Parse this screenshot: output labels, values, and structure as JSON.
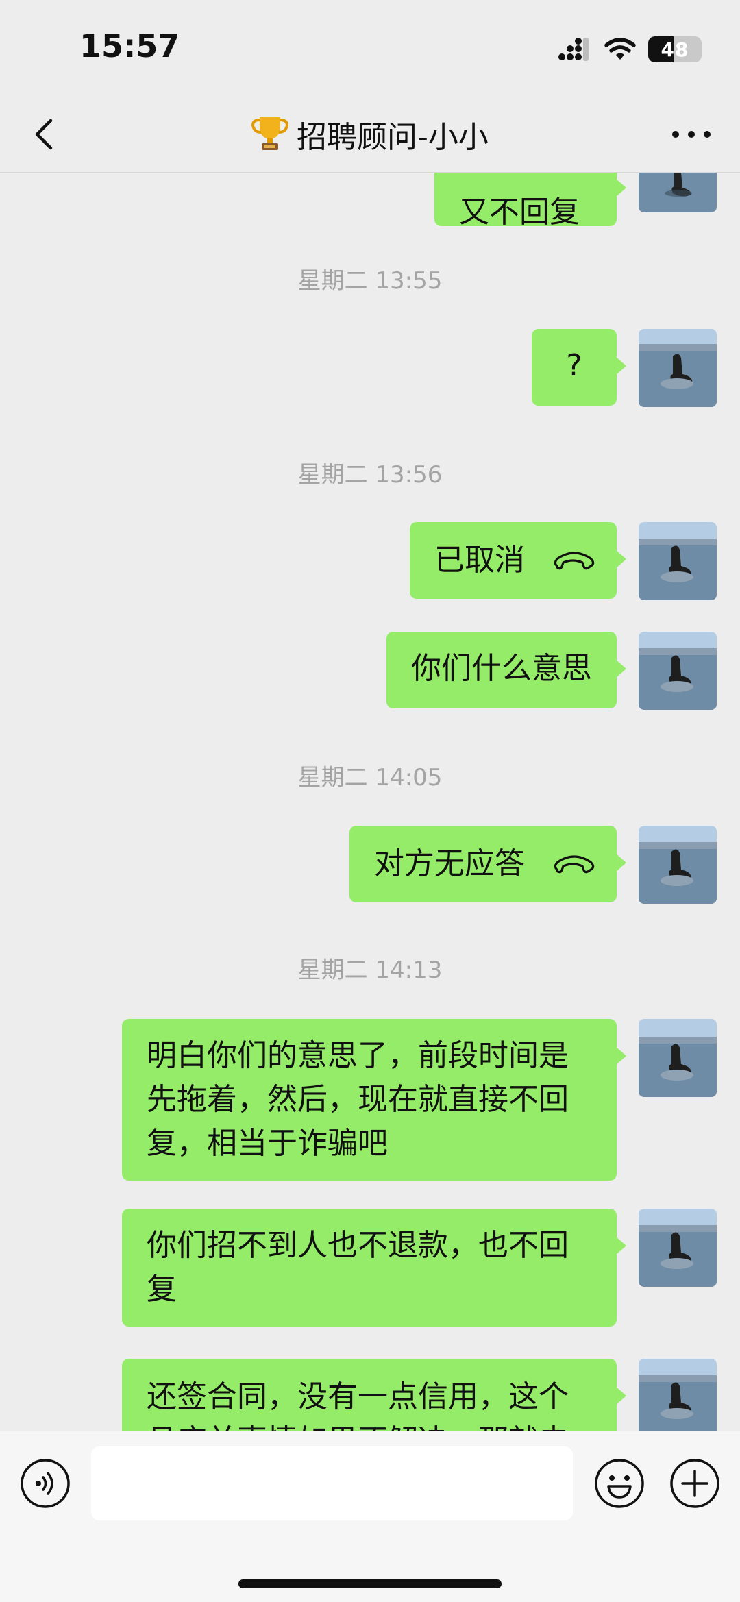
{
  "status_bar": {
    "time": "15:57",
    "battery_level": "48",
    "battery_fraction": 0.48
  },
  "nav": {
    "title": "招聘顾问-小小",
    "title_icon": "trophy-icon"
  },
  "messages": {
    "partial_top": "又不回复",
    "ts1": "星期二 13:55",
    "m1": "?",
    "ts2": "星期二 13:56",
    "m2": "已取消",
    "m3": "你们什么意思",
    "ts3": "星期二 14:05",
    "m4": "对方无应答",
    "ts4": "星期二 14:13",
    "m5_lines": [
      "明白你们的意思了，前段时间是",
      "先拖着，然后，现在就直接不回",
      "复，相当于诈骗吧"
    ],
    "m6_lines": [
      "你们招不到人也不退款，也不回",
      "复"
    ],
    "m7_lines": [
      "还签合同，没有一点信用，这个",
      "且应并事情如果不解决，那就去"
    ]
  },
  "input": {
    "placeholder": ""
  },
  "colors": {
    "background": "#ededed",
    "bubble": "#95ec69",
    "timestamp": "#a4a4a4"
  }
}
